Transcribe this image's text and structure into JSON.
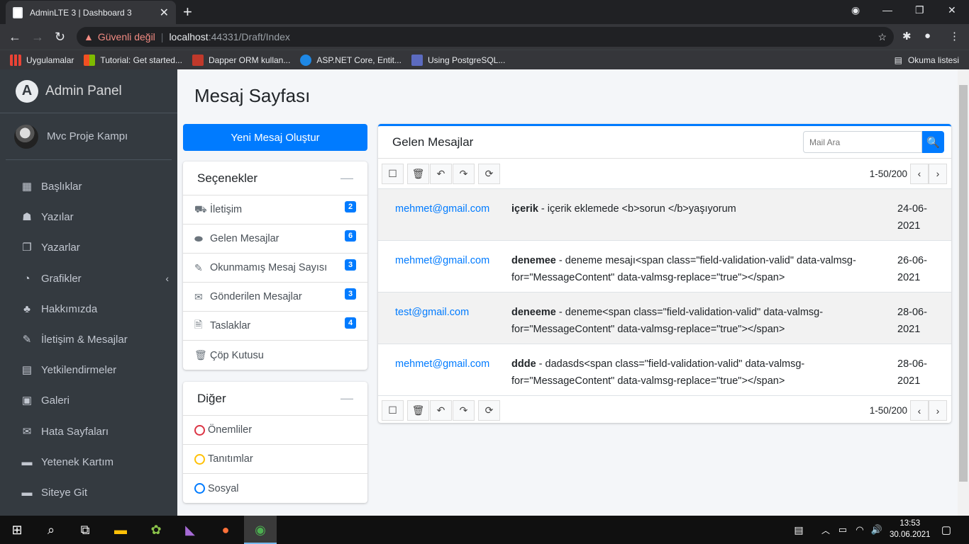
{
  "browser": {
    "tab_title": "AdminLTE 3 | Dashboard 3",
    "security": "Güvenli değil",
    "url_host": "localhost",
    "url_path": ":44331/Draft/Index",
    "bookmarks": [
      "Uygulamalar",
      "Tutorial: Get started...",
      "Dapper ORM kullan...",
      "ASP.NET Core, Entit...",
      "Using PostgreSQL..."
    ],
    "reading_list": "Okuma listesi"
  },
  "sidebar": {
    "brand": "Admin Panel",
    "brand_logo": "A",
    "user": "Mvc Proje Kampı",
    "items": [
      {
        "label": "Başlıklar",
        "icon": "▦"
      },
      {
        "label": "Yazılar",
        "icon": "☗"
      },
      {
        "label": "Yazarlar",
        "icon": "❐"
      },
      {
        "label": "Grafikler",
        "icon": "◔",
        "arrow": "‹"
      },
      {
        "label": "Hakkımızda",
        "icon": "♣"
      },
      {
        "label": "İletişim & Mesajlar",
        "icon": "✎"
      },
      {
        "label": "Yetkilendirmeler",
        "icon": "▤"
      },
      {
        "label": "Galeri",
        "icon": "▣"
      },
      {
        "label": "Hata Sayfaları",
        "icon": "✉"
      },
      {
        "label": "Yetenek Kartım",
        "icon": "▬"
      },
      {
        "label": "Siteye Git",
        "icon": "▬"
      }
    ]
  },
  "page": {
    "title": "Mesaj Sayfası",
    "new_message": "Yeni Mesaj Oluştur"
  },
  "options": {
    "title": "Seçenekler",
    "collapse": "—",
    "folders": [
      {
        "label": "İletişim",
        "icon": "⛟",
        "badge": "2"
      },
      {
        "label": "Gelen Mesajlar",
        "icon": "⬬",
        "badge": "6"
      },
      {
        "label": "Okunmamış Mesaj Sayısı",
        "icon": "✎",
        "badge": "3"
      },
      {
        "label": "Gönderilen Mesajlar",
        "icon": "✉",
        "badge": "3"
      },
      {
        "label": "Taslaklar",
        "icon": "🗎",
        "badge": "4"
      },
      {
        "label": "Çöp Kutusu",
        "icon": "🗑"
      }
    ]
  },
  "other": {
    "title": "Diğer",
    "collapse": "—",
    "labels": [
      {
        "label": "Önemliler",
        "color": "#dc3545"
      },
      {
        "label": "Tanıtımlar",
        "color": "#ffc107"
      },
      {
        "label": "Sosyal",
        "color": "#007bff"
      }
    ]
  },
  "inbox": {
    "title": "Gelen Mesajlar",
    "search_placeholder": "Mail Ara",
    "pagination": "1-50/200",
    "messages": [
      {
        "from": "mehmet@gmail.com",
        "subject": "içerik",
        "preview": " - içerik eklemede <b>sorun </b>yaşıyorum",
        "date": "24-06-2021"
      },
      {
        "from": "mehmet@gmail.com",
        "subject": "denemee",
        "preview": " - deneme mesajı<span class=\"field-validation-valid\" data-valmsg-for=\"MessageContent\" data-valmsg-replace=\"true\"></span>",
        "date": "26-06-2021"
      },
      {
        "from": "test@gmail.com",
        "subject": "deneeme",
        "preview": " - deneme<span class=\"field-validation-valid\" data-valmsg-for=\"MessageContent\" data-valmsg-replace=\"true\"></span>",
        "date": "28-06-2021"
      },
      {
        "from": "mehmet@gmail.com",
        "subject": "ddde",
        "preview": " - dadasds<span class=\"field-validation-valid\" data-valmsg-for=\"MessageContent\" data-valmsg-replace=\"true\"></span>",
        "date": "28-06-2021"
      }
    ]
  },
  "taskbar": {
    "time": "13:53",
    "date": "30.06.2021"
  },
  "colors": {
    "primary": "#007bff",
    "sidebar": "#343a40",
    "danger": "#dc3545",
    "warning": "#ffc107"
  }
}
